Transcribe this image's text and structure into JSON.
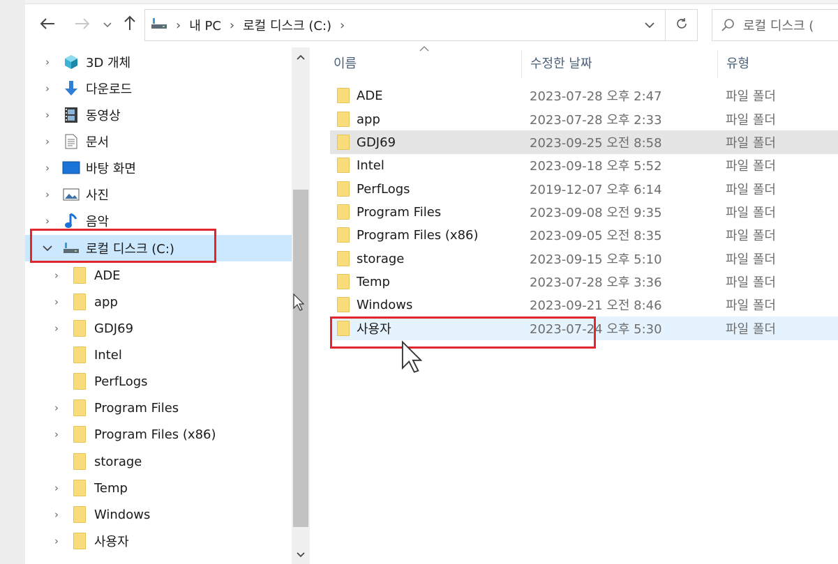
{
  "navigation": {
    "back_icon": "arrow-left-icon",
    "forward_icon": "arrow-right-icon",
    "recent_icon": "chevron-down-icon",
    "up_icon": "arrow-up-icon"
  },
  "address_bar": {
    "icon": "drive-icon",
    "segments": [
      "내 PC",
      "로컬 디스크 (C:)"
    ],
    "dropdown_icon": "chevron-down-icon",
    "refresh_icon": "refresh-icon"
  },
  "search": {
    "placeholder": "로컬 디스크 ("
  },
  "nav_tree": {
    "items": [
      {
        "label": "3D 개체"
      },
      {
        "label": "다운로드"
      },
      {
        "label": "동영상"
      },
      {
        "label": "문서"
      },
      {
        "label": "바탕 화면"
      },
      {
        "label": "사진"
      },
      {
        "label": "음악"
      },
      {
        "label": "로컬 디스크 (C:)"
      }
    ],
    "children": [
      {
        "label": "ADE"
      },
      {
        "label": "app"
      },
      {
        "label": "GDJ69"
      },
      {
        "label": "Intel"
      },
      {
        "label": "PerfLogs"
      },
      {
        "label": "Program Files"
      },
      {
        "label": "Program Files (x86)"
      },
      {
        "label": "storage"
      },
      {
        "label": "Temp"
      },
      {
        "label": "Windows"
      },
      {
        "label": "사용자"
      }
    ]
  },
  "columns": {
    "name": "이름",
    "date": "수정한 날짜",
    "type": "유형"
  },
  "files": [
    {
      "name": "ADE",
      "date": "2023-07-28 오후 2:47",
      "type": "파일 폴더"
    },
    {
      "name": "app",
      "date": "2023-07-28 오후 2:33",
      "type": "파일 폴더"
    },
    {
      "name": "GDJ69",
      "date": "2023-09-25 오전 8:58",
      "type": "파일 폴더"
    },
    {
      "name": "Intel",
      "date": "2023-09-18 오후 5:52",
      "type": "파일 폴더"
    },
    {
      "name": "PerfLogs",
      "date": "2019-12-07 오후 6:14",
      "type": "파일 폴더"
    },
    {
      "name": "Program Files",
      "date": "2023-09-08 오전 9:35",
      "type": "파일 폴더"
    },
    {
      "name": "Program Files (x86)",
      "date": "2023-09-05 오전 8:35",
      "type": "파일 폴더"
    },
    {
      "name": "storage",
      "date": "2023-09-15 오후 5:10",
      "type": "파일 폴더"
    },
    {
      "name": "Temp",
      "date": "2023-07-28 오후 3:36",
      "type": "파일 폴더"
    },
    {
      "name": "Windows",
      "date": "2023-09-21 오전 8:46",
      "type": "파일 폴더"
    },
    {
      "name": "사용자",
      "date": "2023-07-24 오후 5:30",
      "type": "파일 폴더"
    }
  ],
  "colors": {
    "selection": "#cce8ff",
    "highlight_box": "#e3262b",
    "folder": "#f8dd7a"
  }
}
